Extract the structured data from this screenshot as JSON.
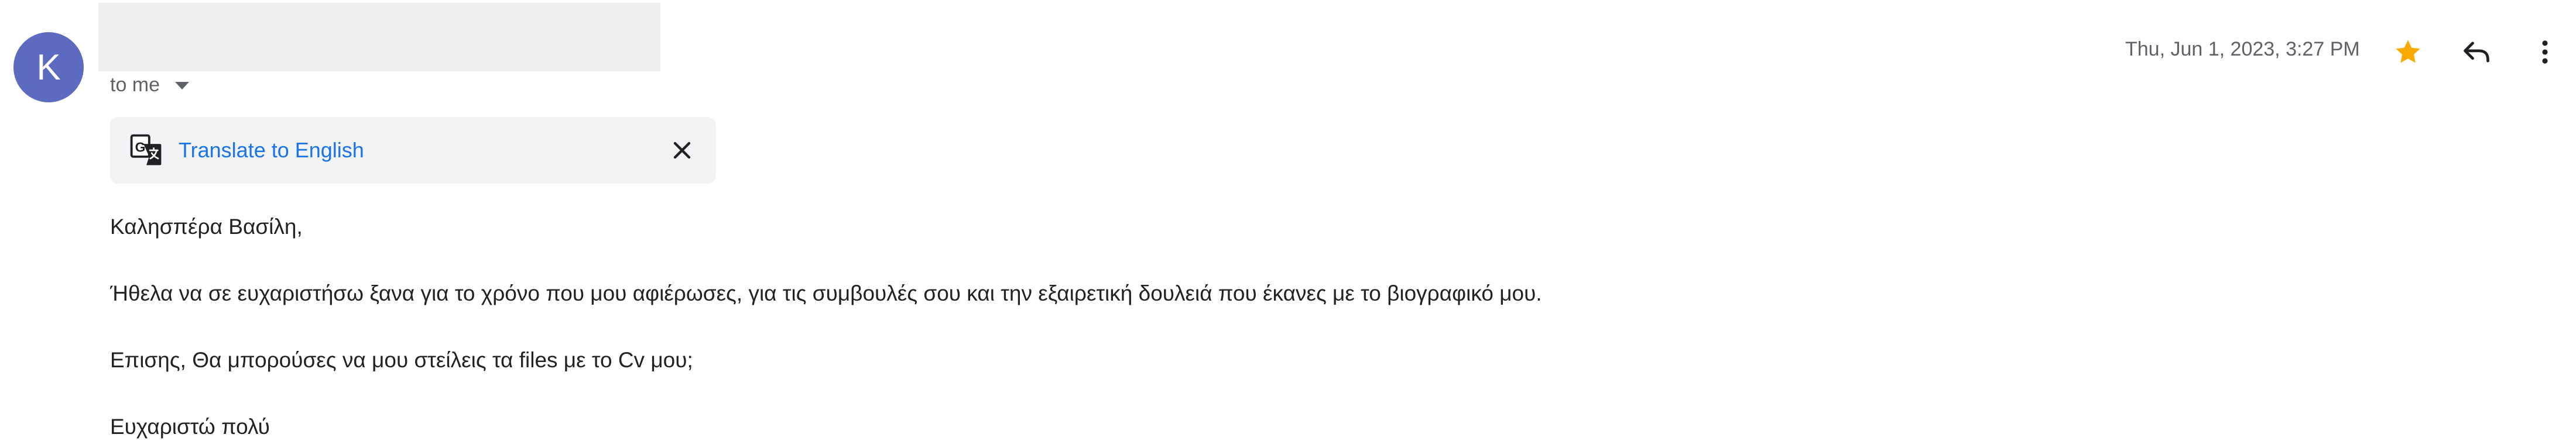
{
  "sender": {
    "avatar_letter": "K",
    "avatar_color": "#5c6bc0"
  },
  "recipient": {
    "label": "to me"
  },
  "translate": {
    "link_label": "Translate to English"
  },
  "header": {
    "date": "Thu, Jun 1, 2023, 3:27 PM"
  },
  "icons": {
    "avatar": "avatar",
    "caret": "chevron-down-icon",
    "translate": "translate-icon",
    "close": "close-icon",
    "star": "star-icon",
    "reply": "reply-icon",
    "more": "more-vert-icon"
  },
  "colors": {
    "star": "#f9ab00",
    "link": "#1a73e8"
  },
  "body": {
    "greeting": "Καλησπέρα Βασίλη,",
    "paragraph1": "Ήθελα να σε ευχαριστήσω ξανα για το χρόνο που μου αφιέρωσες, για τις συμβουλές σου και την εξαιρετική δουλειά που έκανες με το βιογραφικό μου.",
    "paragraph2": "Επισης, Θα μπορούσες να μου στείλεις τα files με το Cv μου;",
    "closing": "Ευχαριστώ πολύ"
  }
}
